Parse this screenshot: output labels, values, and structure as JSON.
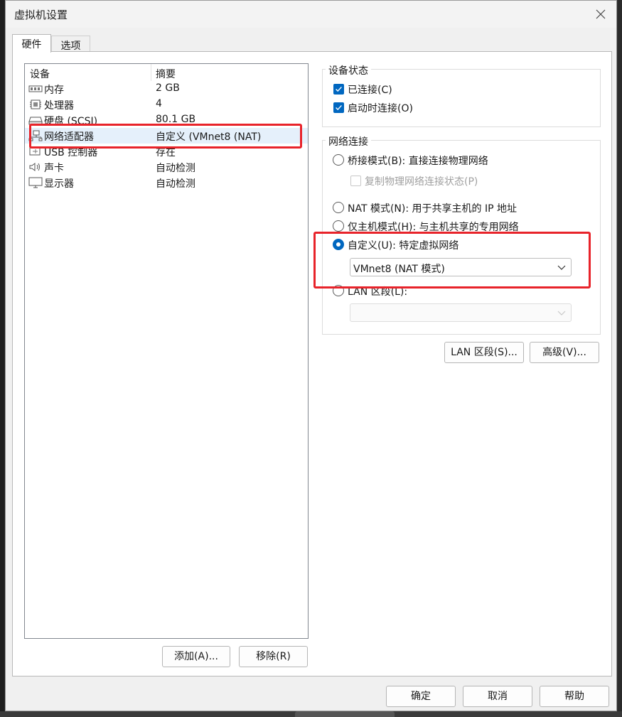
{
  "dialog": {
    "title": "虚拟机设置"
  },
  "tabs": [
    {
      "label": "硬件",
      "active": true
    },
    {
      "label": "选项",
      "active": false
    }
  ],
  "device_list": {
    "columns": [
      "设备",
      "摘要"
    ],
    "rows": [
      {
        "name": "内存",
        "summary": "2 GB",
        "icon": "memory-icon"
      },
      {
        "name": "处理器",
        "summary": "4",
        "icon": "processor-icon"
      },
      {
        "name": "硬盘 (SCSI)",
        "summary": "80.1 GB",
        "icon": "hard-disk-icon"
      },
      {
        "name": "网络适配器",
        "summary": "自定义 (VMnet8 (NAT)",
        "icon": "network-adapter-icon",
        "selected": true
      },
      {
        "name": "USB 控制器",
        "summary": "存在",
        "icon": "usb-icon"
      },
      {
        "name": "声卡",
        "summary": "自动检测",
        "icon": "speaker-icon"
      },
      {
        "name": "显示器",
        "summary": "自动检测",
        "icon": "monitor-icon"
      }
    ]
  },
  "device_buttons": {
    "add": "添加(A)...",
    "remove": "移除(R)"
  },
  "device_status": {
    "title": "设备状态",
    "connected": "已连接(C)",
    "connect_at_power_on": "启动时连接(O)"
  },
  "network": {
    "title": "网络连接",
    "bridged": "桥接模式(B): 直接连接物理网络",
    "replicate": "复制物理网络连接状态(P)",
    "nat": "NAT 模式(N): 用于共享主机的 IP 地址",
    "host_only": "仅主机模式(H): 与主机共享的专用网络",
    "custom": "自定义(U): 特定虚拟网络",
    "custom_value": "VMnet8 (NAT 模式)",
    "lan_segment": "LAN 区段(L):",
    "lan_value": ""
  },
  "right_buttons": {
    "lan_segments": "LAN 区段(S)...",
    "advanced": "高级(V)..."
  },
  "footer": {
    "ok": "确定",
    "cancel": "取消",
    "help": "帮助"
  },
  "colors": {
    "accent": "#0067c0",
    "highlight": "#e8232a",
    "selected_row": "#e5f0fb"
  }
}
